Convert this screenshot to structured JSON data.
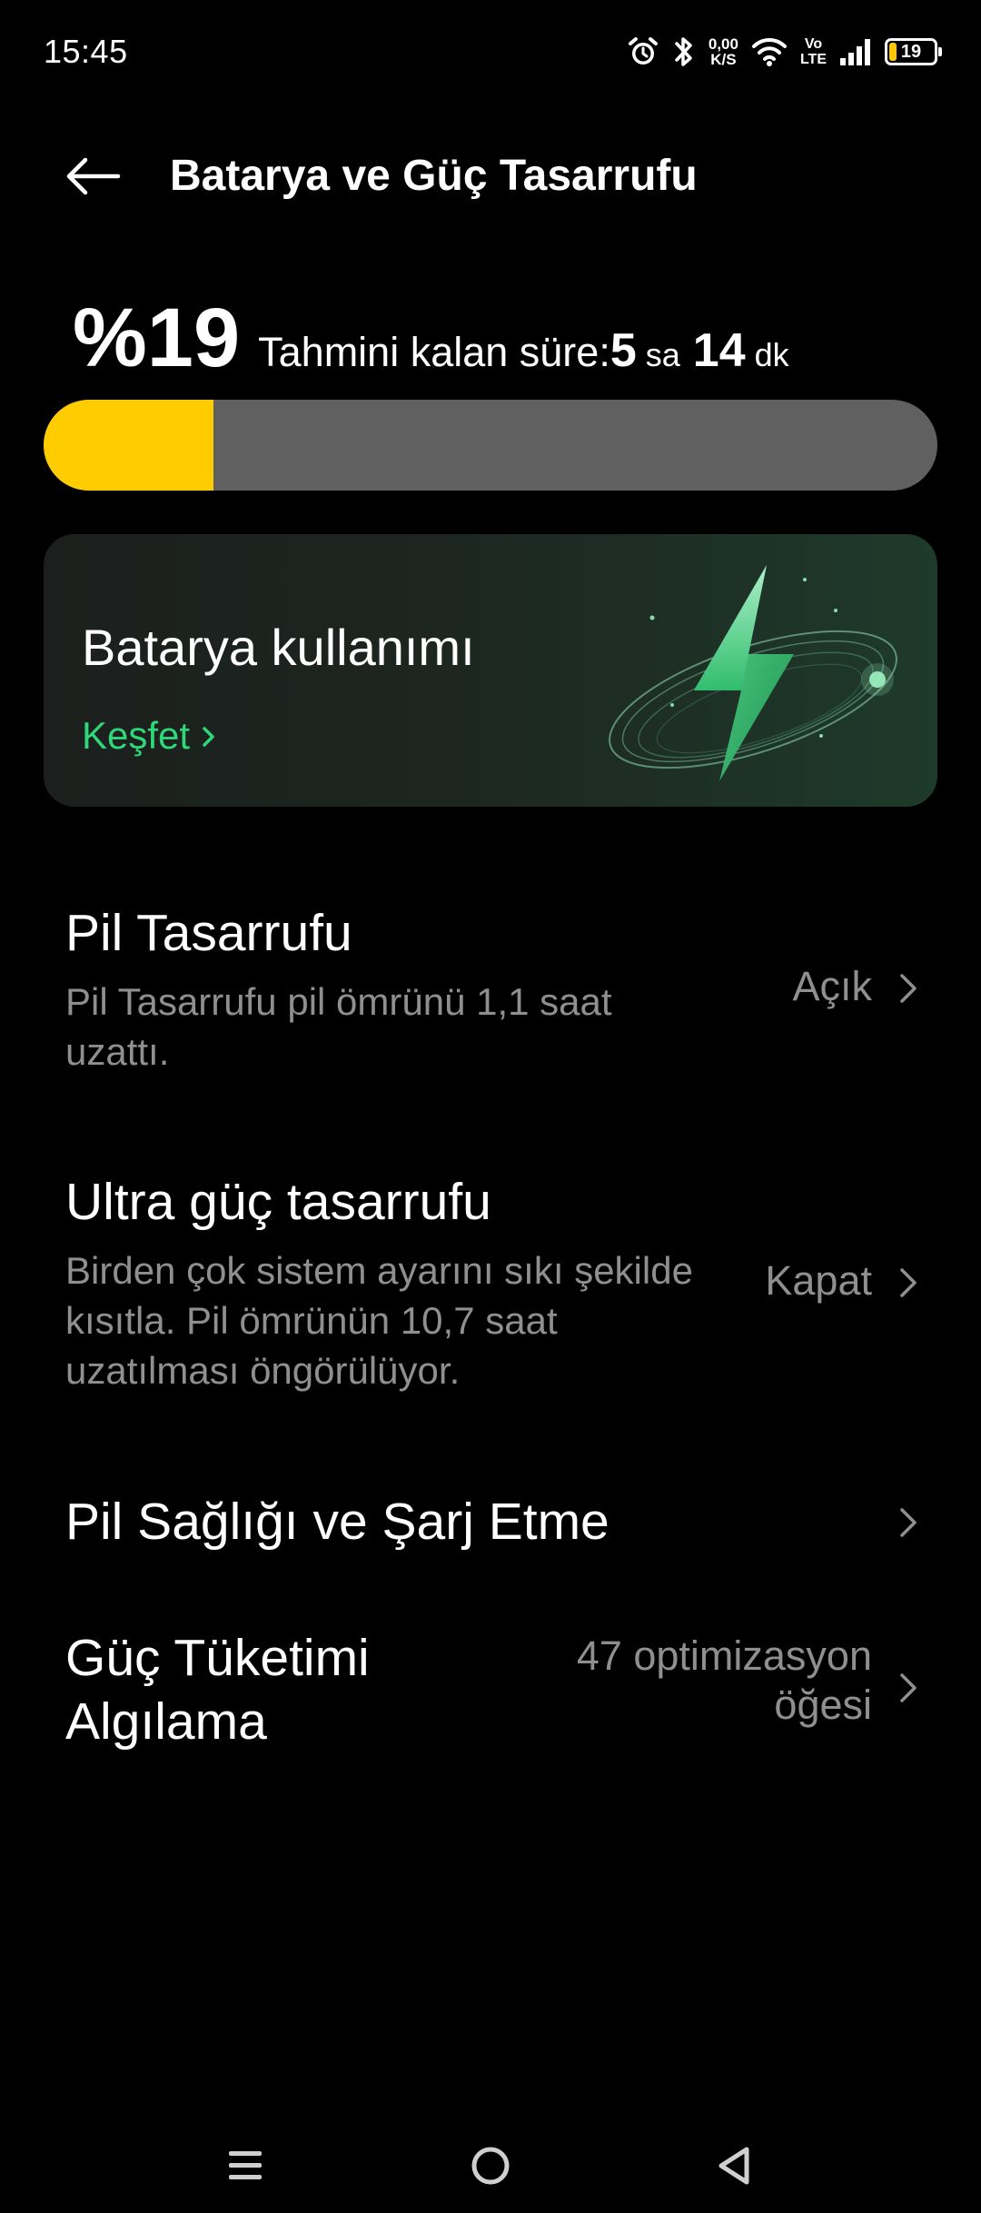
{
  "status_bar": {
    "time": "15:45",
    "net_speed_value": "0,00",
    "net_speed_unit": "K/S",
    "volte_top": "Vo",
    "volte_bottom": "LTE",
    "battery_level": "19",
    "battery_fill_fraction": 0.19,
    "icons": [
      "alarm-icon",
      "bluetooth-icon",
      "wifi-icon",
      "signal-icon",
      "battery-icon"
    ]
  },
  "header": {
    "title": "Batarya ve Güç Tasarrufu",
    "back_icon": "back-arrow-icon"
  },
  "battery": {
    "percent_text": "%19",
    "percent_value": 19,
    "remaining_label": "Tahmini kalan süre:",
    "hours": "5",
    "hours_unit": "sa",
    "minutes": "14",
    "minutes_unit": "dk",
    "fill_color": "#ffcc00"
  },
  "usage_card": {
    "title": "Batarya kullanımı",
    "link_label": "Keşfet",
    "link_color": "#2fd67a",
    "illustration": "lightning-bolt-icon"
  },
  "settings": [
    {
      "title": "Pil Tasarrufu",
      "description": "Pil Tasarrufu pil ömrünü 1,1 saat uzattı.",
      "value": "Açık"
    },
    {
      "title": "Ultra güç tasarrufu",
      "description": "Birden çok sistem ayarını sıkı şekilde kısıtla. Pil ömrünün 10,7 saat uzatılması öngörülüyor.",
      "value": "Kapat"
    },
    {
      "title": "Pil Sağlığı ve Şarj Etme",
      "description": "",
      "value": ""
    },
    {
      "title_line1": "Güç Tüketimi",
      "title_line2": "Algılama",
      "value_line1": "47 optimizasyon",
      "value_line2": "öğesi"
    }
  ],
  "nav_bar": {
    "icons": [
      "menu-icon",
      "home-icon",
      "back-icon"
    ]
  }
}
